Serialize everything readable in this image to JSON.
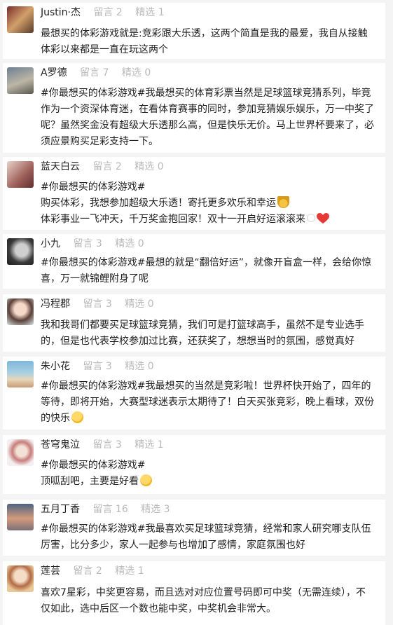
{
  "labels": {
    "comments": "留言",
    "featured": "精选"
  },
  "posts": [
    {
      "username": "Justin·杰",
      "comments": "2",
      "featured": "1",
      "lines": [
        "最想买的体彩游戏就是:竞彩跟大乐透，这两个简直是我的最爱，我自从接触",
        "体彩以来都是一直在玩这两个"
      ]
    },
    {
      "username": "A罗德",
      "comments": "7",
      "featured": "0",
      "lines": [
        "#你最想买的体彩游戏#我最想买的体育彩票当然是足球篮球竞猜系列，毕竟",
        "作为一个资深体育迷，在看体育赛事的同时，参加竞猜娱乐娱乐，万一中奖了",
        "呢？虽然奖金没有超级大乐透那么高，但是快乐无价。马上世界杯要来了，必",
        "须应景购买足彩支持一下。"
      ]
    },
    {
      "username": "蓝天白云",
      "comments": "2",
      "featured": "0",
      "lines": [
        "#你最想买的体彩游戏#",
        "购买体彩，我想参加超级大乐透！寄托更多欢乐和幸运",
        "体彩事业一飞冲天，千万奖金抱回家！双十一开启好运滚滚来"
      ]
    },
    {
      "username": "小九",
      "comments": "3",
      "featured": "0",
      "lines": [
        "#你最想买的体彩游戏#最想的就是“翻倍好运”，就像开盲盒一样，会给你惊",
        "喜，万一就锦鲤附身了呢"
      ]
    },
    {
      "username": "冯程郡",
      "comments": "3",
      "featured": "0",
      "lines": [
        "我和我哥们都要买足球篮球竞猜，我们可是打篮球高手，虽然不是专业选手",
        "的，但是也代表学校参加过比赛，还获奖了，想想当时的氛围，感觉真好"
      ]
    },
    {
      "username": "朱小花",
      "comments": "3",
      "featured": "0",
      "lines": [
        "#你最想买的体彩游戏#我最想买的当然是竞彩啦！世界杯快开始了，四年的",
        "等待，即将开始，大赛型球迷表示太期待了！白天买张竞彩，晚上看球，双份",
        "的快乐"
      ]
    },
    {
      "username": "苍穹鬼泣",
      "comments": "3",
      "featured": "1",
      "lines": [
        "#你最想买的体彩游戏#",
        "顶呱刮吧，主要是好看"
      ]
    },
    {
      "username": "五月丁香",
      "comments": "16",
      "featured": "3",
      "lines": [
        "#你最想买的体彩游戏#我最喜欢买足球篮球竞猜，经常和家人研究哪支队伍",
        "厉害，比分多少，家人一起参与也增加了感情，家庭氛围也好"
      ]
    },
    {
      "username": "莲芸",
      "comments": "2",
      "featured": "1",
      "lines": [
        "喜欢7星彩，中奖更容易，而且选对对应位置号码即可中奖（无需连续），不",
        "仅如此，选中后区一个数也能中奖，中奖机会非常大。"
      ]
    }
  ]
}
